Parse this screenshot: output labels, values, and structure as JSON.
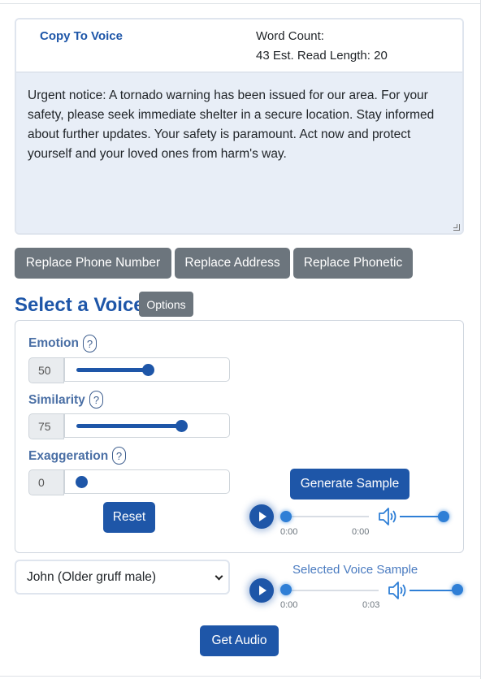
{
  "copy": {
    "title": "Copy To Voice",
    "word_count_line1": "Word Count:",
    "word_count_line2": "43 Est. Read Length: 20",
    "text": "Urgent notice: A tornado warning has been issued for our area. For your safety, please seek immediate shelter in a secure location. Stay informed about further updates. Your safety is paramount. Act now and protect yourself and your loved ones from harm's way."
  },
  "replace_buttons": [
    "Replace Phone Number",
    "Replace Address",
    "Replace Phonetic"
  ],
  "select_voice": {
    "heading": "Select a Voice",
    "options_label": "Options"
  },
  "sliders": {
    "emotion": {
      "label": "Emotion",
      "help": "?",
      "value": "50"
    },
    "similarity": {
      "label": "Similarity",
      "help": "?",
      "value": "75"
    },
    "exaggeration": {
      "label": "Exaggeration",
      "help": "?",
      "value": "0"
    }
  },
  "reset_label": "Reset",
  "generate_label": "Generate Sample",
  "sample_player": {
    "current": "0:00",
    "duration": "0:00"
  },
  "voice_dropdown": {
    "selected": "John (Older gruff male)"
  },
  "selected_sample": {
    "label": "Selected Voice Sample",
    "current": "0:00",
    "duration": "0:03"
  },
  "get_audio_label": "Get Audio",
  "colors": {
    "primary": "#1e56a8",
    "secondary": "#6c757d",
    "textarea_bg": "#e8eef7"
  }
}
